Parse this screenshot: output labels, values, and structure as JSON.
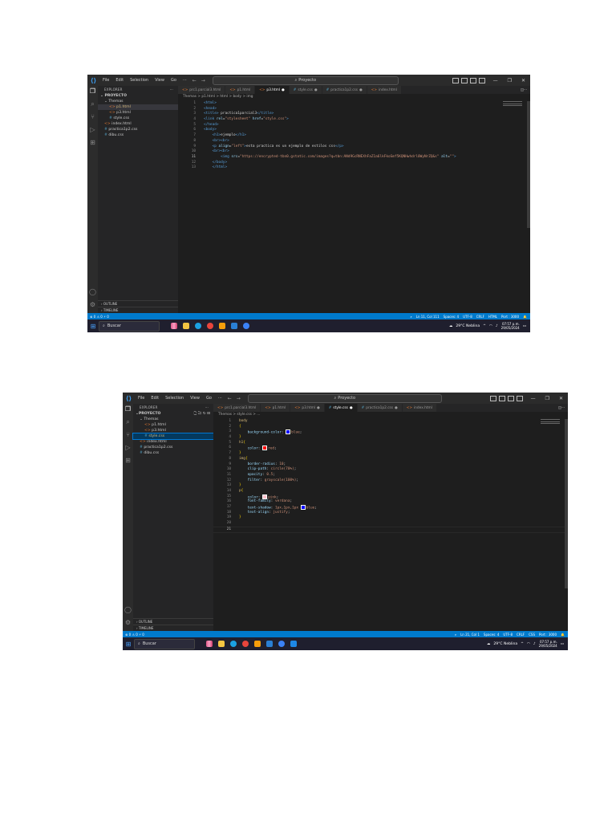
{
  "screenshots": [
    {
      "titlebar": {
        "menu": [
          "File",
          "Edit",
          "Selection",
          "View",
          "Go",
          "···"
        ],
        "search": "Proyecto"
      },
      "sidebar": {
        "title": "EXPLORER",
        "more": "···",
        "project": "PROYECTO",
        "items": [
          {
            "label": "Themas",
            "kind": "folder",
            "indent": 1
          },
          {
            "label": "p1.html",
            "kind": "html",
            "indent": 2,
            "selected": true
          },
          {
            "label": "p3.html",
            "kind": "html",
            "indent": 2
          },
          {
            "label": "style.css",
            "kind": "css",
            "indent": 2
          },
          {
            "label": "index.html",
            "kind": "html",
            "indent": 1
          },
          {
            "label": "practica1p2.css",
            "kind": "css",
            "indent": 1
          },
          {
            "label": "dibu.css",
            "kind": "css",
            "indent": 1
          }
        ],
        "outline": "OUTLINE",
        "timeline": "TIMELINE"
      },
      "tabs": [
        {
          "label": "prc1.parcial3.html",
          "kind": "html"
        },
        {
          "label": "p1.html",
          "kind": "html"
        },
        {
          "label": "p3.html",
          "kind": "html",
          "active": true
        },
        {
          "label": "style.css",
          "kind": "css"
        },
        {
          "label": "practica1p2.css",
          "kind": "css"
        },
        {
          "label": "index.html",
          "kind": "html"
        }
      ],
      "breadcrumb": "Themas > p1.html > html > body > img",
      "code": [
        "<html>",
        "<head>",
        "<title> practica1parcial3</title>",
        "<link rel=\"stylesheet\" href=\"style.css\">",
        "</head>",
        "<body>",
        "    <h1>ejemplo</h1>",
        "    <br><br>",
        "    <p align=\"left\">esta practica es un ejemplo de estilos css</p>",
        "    <br><br>",
        "        <img src=\"https://encrypted-tbn0.gstatic.com/images?q=tbn:ANd9GcRNEXhFaZ1a6lkFkoSmf5KQNHwhdrl0WyNrZQ&s\" alt=\"\">",
        "    </body>",
        "    </html>"
      ],
      "current_line": 11,
      "status": {
        "left": "⊗ 0 ⚠ 0   ⚡ 0",
        "right": [
          "Ln 11, Col 111",
          "Spaces: 4",
          "UTF-8",
          "CRLF",
          "HTML",
          "Port : 3000"
        ]
      },
      "taskbar": {
        "search": "Buscar",
        "weather": "29°C Neblina",
        "time": "07:57 p.m.",
        "date": "29/05/2024"
      }
    },
    {
      "titlebar": {
        "menu": [
          "File",
          "Edit",
          "Selection",
          "View",
          "Go",
          "···"
        ],
        "search": "Proyecto"
      },
      "sidebar": {
        "title": "EXPLORER",
        "more": "···",
        "project": "PROYECTO",
        "items": [
          {
            "label": "Themas",
            "kind": "folder",
            "indent": 1
          },
          {
            "label": "p1.html",
            "kind": "html",
            "indent": 2
          },
          {
            "label": "p3.html",
            "kind": "html",
            "indent": 2
          },
          {
            "label": "style.css",
            "kind": "css",
            "indent": 2,
            "selected": true
          },
          {
            "label": "index.html",
            "kind": "html",
            "indent": 1
          },
          {
            "label": "practica1p2.css",
            "kind": "css",
            "indent": 1
          },
          {
            "label": "dibu.css",
            "kind": "css",
            "indent": 1
          }
        ],
        "outline": "OUTLINE",
        "timeline": "TIMELINE"
      },
      "tabs": [
        {
          "label": "prc1.parcial3.html",
          "kind": "html"
        },
        {
          "label": "p1.html",
          "kind": "html"
        },
        {
          "label": "p3.html",
          "kind": "html"
        },
        {
          "label": "style.css",
          "kind": "css",
          "active": true
        },
        {
          "label": "practica1p2.css",
          "kind": "css"
        },
        {
          "label": "index.html",
          "kind": "html"
        }
      ],
      "breadcrumb": "Themas > style.css > ...",
      "css_code": [
        "body",
        "{",
        "    background-color: blue;",
        "}",
        "h1{",
        "    color: red;",
        "}",
        "img{",
        "    border-radius: 10;",
        "    clip-path: circle(70%);",
        "    opacity: 0.5;",
        "    filter: grayscale(100%);",
        "}",
        "p{",
        "    color: pink;",
        "    font-family: verdana;",
        "    text-shadow: 1px,1px,1px blue;",
        "    text-align: justify;",
        "}",
        "",
        ""
      ],
      "current_line": 21,
      "status": {
        "left": "⊗ 0 ⚠ 0   ⚡ 0",
        "right": [
          "Ln 21, Col 1",
          "Spaces: 4",
          "UTF-8",
          "CRLF",
          "CSS",
          "Port : 3000"
        ]
      },
      "taskbar": {
        "search": "Buscar",
        "weather": "29°C Neblina",
        "time": "07:57 p.m.",
        "date": "29/05/2024"
      }
    }
  ],
  "colors": {
    "accent": "#007acc",
    "editor_bg": "#1e1e1e",
    "sidebar_bg": "#252526",
    "swatch_blue": "#0000ff",
    "swatch_red": "#ff0000",
    "swatch_pink": "#ffc0cb"
  }
}
